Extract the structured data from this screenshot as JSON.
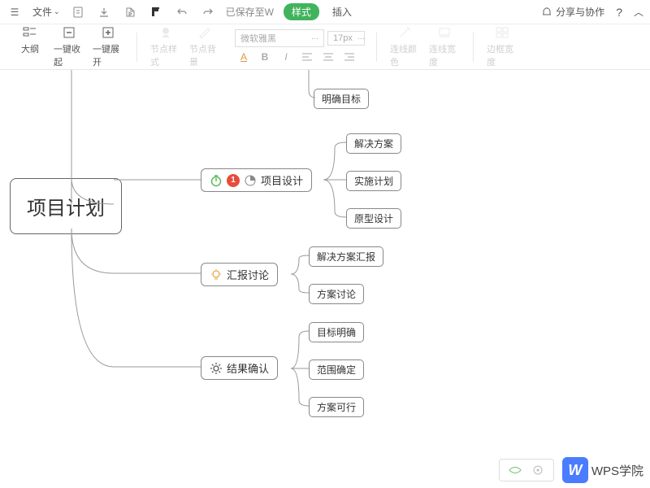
{
  "topbar": {
    "file_label": "文件",
    "saved_text": "已保存至W",
    "pill": "样式",
    "insert_label": "插入",
    "share_label": "分享与协作",
    "help_label": "?"
  },
  "toolbar": {
    "outline": "大纲",
    "collapse": "一键收起",
    "expand": "一键展开",
    "node_style": "节点样式",
    "node_bg": "节点背景",
    "font_name": "微软雅黑",
    "font_size": "17px",
    "connector_color": "连线颜色",
    "connector_width": "连线宽度",
    "border_width": "边框宽度"
  },
  "mindmap": {
    "root": "项目计划",
    "nodes": [
      {
        "label": "明确目标",
        "children": []
      },
      {
        "label": "项目设计",
        "icons": [
          "timer-green",
          "badge-1",
          "pie"
        ],
        "children": [
          "解决方案",
          "实施计划",
          "原型设计"
        ]
      },
      {
        "label": "汇报讨论",
        "icons": [
          "lightbulb"
        ],
        "children": [
          "解决方案汇报",
          "方案讨论"
        ]
      },
      {
        "label": "结果确认",
        "icons": [
          "gear"
        ],
        "children": [
          "目标明确",
          "范围确定",
          "方案可行"
        ]
      }
    ],
    "badge_value": "1"
  },
  "logo": {
    "text": "WPS学院",
    "mark": "W"
  }
}
